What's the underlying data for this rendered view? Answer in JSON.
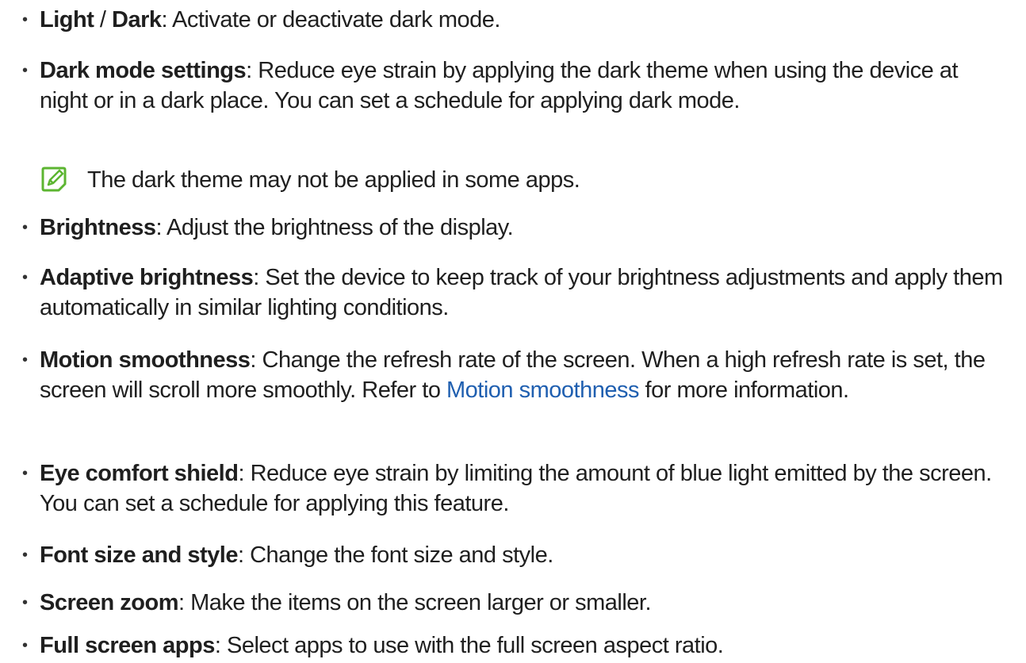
{
  "items": [
    {
      "term": "Light",
      "sep": " / ",
      "term2": "Dark",
      "desc": ": Activate or deactivate dark mode."
    },
    {
      "term": "Dark mode settings",
      "desc": ": Reduce eye strain by applying the dark theme when using the device at night or in a dark place. You can set a schedule for applying dark mode."
    },
    {
      "term": "Brightness",
      "desc": ": Adjust the brightness of the display."
    },
    {
      "term": "Adaptive brightness",
      "desc": ": Set the device to keep track of your brightness adjustments and apply them automatically in similar lighting conditions."
    },
    {
      "term": "Motion smoothness",
      "desc": ": Change the refresh rate of the screen. When a high refresh rate is set, the screen will scroll more smoothly. Refer to ",
      "link": "Motion smoothness",
      "desc2": " for more information."
    },
    {
      "term": "Eye comfort shield",
      "desc": ": Reduce eye strain by limiting the amount of blue light emitted by the screen. You can set a schedule for applying this feature."
    },
    {
      "term": "Font size and style",
      "desc": ": Change the font size and style."
    },
    {
      "term": "Screen zoom",
      "desc": ": Make the items on the screen larger or smaller."
    },
    {
      "term": "Full screen apps",
      "desc": ": Select apps to use with the full screen aspect ratio."
    }
  ],
  "note": {
    "icon": "note-pencil-icon",
    "text": "The dark theme may not be applied in some apps."
  },
  "colors": {
    "link": "#1f5fb0",
    "note_icon": "#5cb531",
    "text": "#1f1f1f"
  }
}
